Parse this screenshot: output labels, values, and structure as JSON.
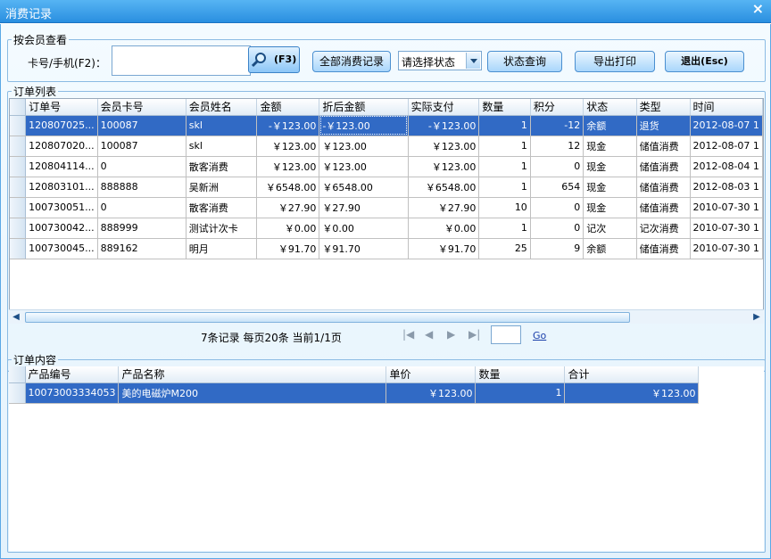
{
  "window": {
    "title": "消费记录",
    "close_glyph": "×"
  },
  "member_query": {
    "legend": "按会员查看",
    "card_label": "卡号/手机(F2)：",
    "card_value": "",
    "search_key": "(F3)",
    "all_records_label": "全部消费记录",
    "status_select": "请选择状态",
    "status_query_label": "状态查询",
    "export_print_label": "导出打印",
    "exit_label": "退出(Esc)"
  },
  "orders": {
    "legend": "订单列表",
    "columns": [
      "订单号",
      "会员卡号",
      "会员姓名",
      "金额",
      "折后金额",
      "实际支付",
      "数量",
      "积分",
      "状态",
      "类型",
      "时间"
    ],
    "rows": [
      {
        "order_no": "120807025...",
        "card_no": "100087",
        "name": "skl",
        "amount": "-￥123.00",
        "discounted": "-￥123.00",
        "paid": "-￥123.00",
        "qty": "1",
        "points": "-12",
        "status": "余额",
        "type": "退货",
        "time": "2012-08-07 1"
      },
      {
        "order_no": "120807020...",
        "card_no": "100087",
        "name": "skl",
        "amount": "￥123.00",
        "discounted": "￥123.00",
        "paid": "￥123.00",
        "qty": "1",
        "points": "12",
        "status": "现金",
        "type": "储值消费",
        "time": "2012-08-07 1"
      },
      {
        "order_no": "120804114...",
        "card_no": "0",
        "name": "散客消费",
        "amount": "￥123.00",
        "discounted": "￥123.00",
        "paid": "￥123.00",
        "qty": "1",
        "points": "0",
        "status": "现金",
        "type": "储值消费",
        "time": "2012-08-04 1"
      },
      {
        "order_no": "120803101...",
        "card_no": "888888",
        "name": "吴新洲",
        "amount": "￥6548.00",
        "discounted": "￥6548.00",
        "paid": "￥6548.00",
        "qty": "1",
        "points": "654",
        "status": "现金",
        "type": "储值消费",
        "time": "2012-08-03 1"
      },
      {
        "order_no": "100730051...",
        "card_no": "0",
        "name": "散客消费",
        "amount": "￥27.90",
        "discounted": "￥27.90",
        "paid": "￥27.90",
        "qty": "10",
        "points": "0",
        "status": "现金",
        "type": "储值消费",
        "time": "2010-07-30 1"
      },
      {
        "order_no": "100730042...",
        "card_no": "888999",
        "name": "测试计次卡",
        "amount": "￥0.00",
        "discounted": "￥0.00",
        "paid": "￥0.00",
        "qty": "1",
        "points": "0",
        "status": "记次",
        "type": "记次消费",
        "time": "2010-07-30 1"
      },
      {
        "order_no": "100730045...",
        "card_no": "889162",
        "name": "明月",
        "amount": "￥91.70",
        "discounted": "￥91.70",
        "paid": "￥91.70",
        "qty": "25",
        "points": "9",
        "status": "余额",
        "type": "储值消费",
        "time": "2010-07-30 1"
      }
    ],
    "selected_row": 0,
    "pager_text": "7条记录 每页20条 当前1/1页",
    "page_input": "",
    "go_label": "Go"
  },
  "order_items": {
    "legend": "订单内容",
    "columns": [
      "产品编号",
      "产品名称",
      "单价",
      "数量",
      "合计"
    ],
    "rows": [
      {
        "code": "10073003334053",
        "name": "美的电磁炉M200",
        "price": "￥123.00",
        "qty": "1",
        "total": "￥123.00"
      }
    ],
    "selected_row": 0
  },
  "icons": {
    "search": "magnifier-icon",
    "close": "close-icon",
    "first": "first-page-icon",
    "prev": "prev-page-icon",
    "next": "next-page-icon",
    "last": "last-page-icon"
  },
  "colors": {
    "titlebar": "#2a8fe0",
    "selection": "#316ac5",
    "button": "#a9d6fb"
  }
}
